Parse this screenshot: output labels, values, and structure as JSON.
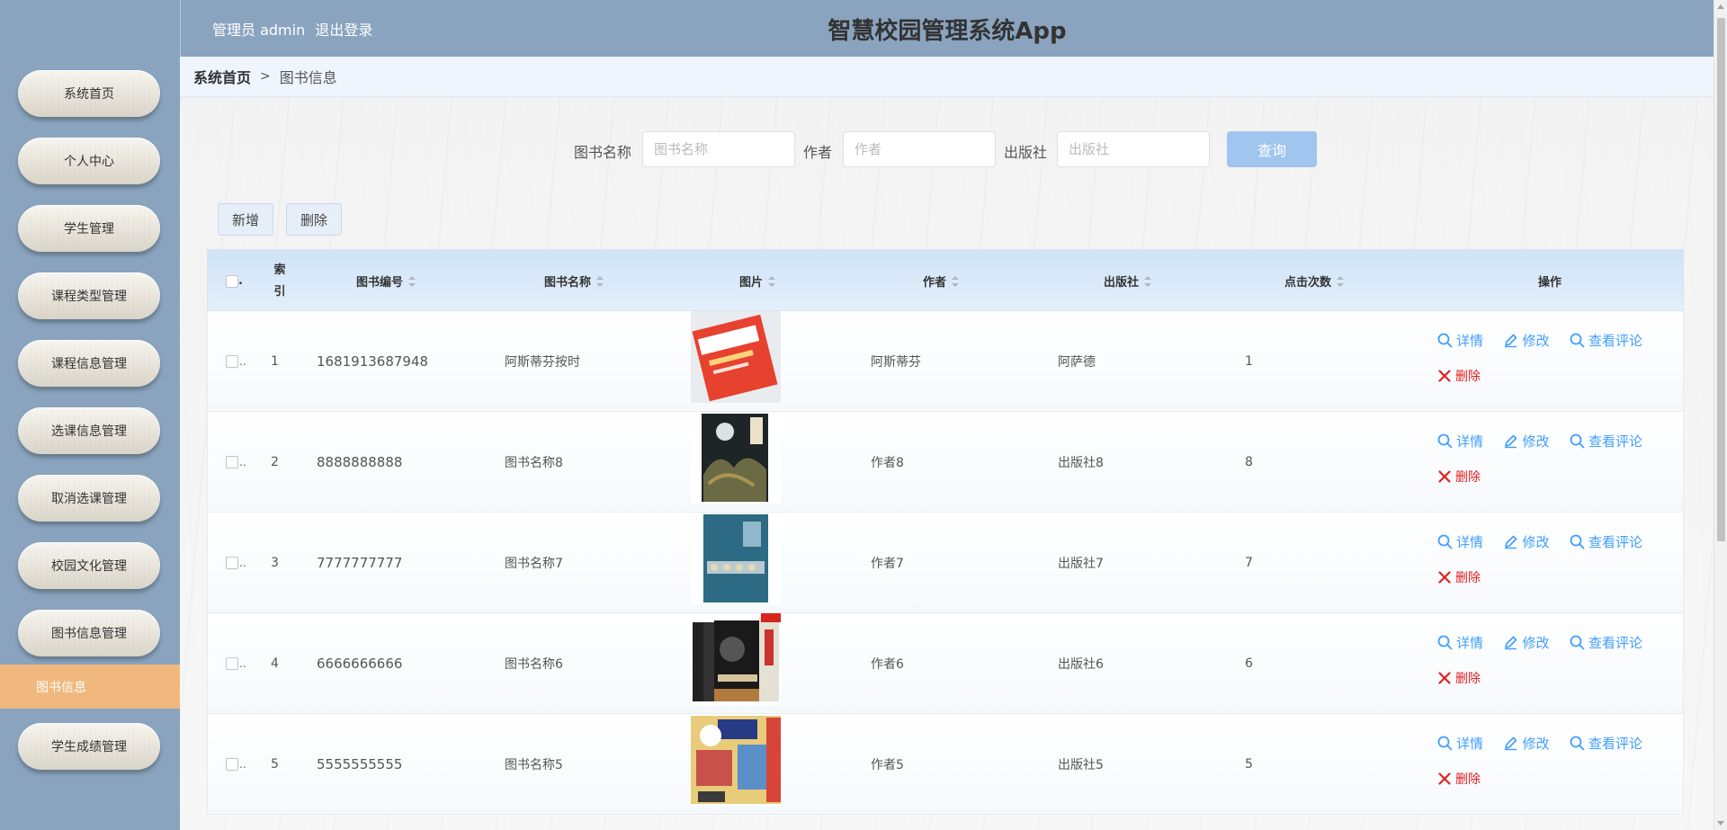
{
  "header": {
    "user_role": "管理员 admin",
    "logout": "退出登录",
    "app_title": "智慧校园管理系统App"
  },
  "sidebar": {
    "items": [
      {
        "label": "系统首页"
      },
      {
        "label": "个人中心"
      },
      {
        "label": "学生管理"
      },
      {
        "label": "课程类型管理"
      },
      {
        "label": "课程信息管理"
      },
      {
        "label": "选课信息管理"
      },
      {
        "label": "取消选课管理"
      },
      {
        "label": "校园文化管理"
      },
      {
        "label": "图书信息管理"
      }
    ],
    "active_sub": "图书信息",
    "last_item": "学生成绩管理",
    "active_color": "#f0b87e"
  },
  "breadcrumb": {
    "home": "系统首页",
    "separator": ">",
    "current": "图书信息"
  },
  "search": {
    "name_label": "图书名称",
    "name_placeholder": "图书名称",
    "author_label": "作者",
    "author_placeholder": "作者",
    "publisher_label": "出版社",
    "publisher_placeholder": "出版社",
    "query_button": "查询"
  },
  "actions": {
    "add": "新增",
    "delete": "删除"
  },
  "table": {
    "headers": {
      "index": "索引",
      "book_no": "图书编号",
      "book_name": "图书名称",
      "image": "图片",
      "author": "作者",
      "publisher": "出版社",
      "clicks": "点击次数",
      "ops": "操作"
    },
    "checkbox_suffix": "..",
    "ops": {
      "detail": "详情",
      "edit": "修改",
      "comments": "查看评论",
      "delete": "删除"
    },
    "rows": [
      {
        "index": "1",
        "book_no": "1681913687948",
        "book_name": "阿斯蒂芬按时",
        "author": "阿斯蒂芬",
        "publisher": "阿萨德",
        "clicks": "1",
        "cover": "red-textbook"
      },
      {
        "index": "2",
        "book_no": "8888888888",
        "book_name": "图书名称8",
        "author": "作者8",
        "publisher": "出版社8",
        "clicks": "8",
        "cover": "dark-fantasy"
      },
      {
        "index": "3",
        "book_no": "7777777777",
        "book_name": "图书名称7",
        "author": "作者7",
        "publisher": "出版社7",
        "clicks": "7",
        "cover": "blue-gems"
      },
      {
        "index": "4",
        "book_no": "6666666666",
        "book_name": "图书名称6",
        "author": "作者6",
        "publisher": "出版社6",
        "clicks": "6",
        "cover": "boxed-set"
      },
      {
        "index": "5",
        "book_no": "5555555555",
        "book_name": "图书名称5",
        "author": "作者5",
        "publisher": "出版社5",
        "clicks": "5",
        "cover": "one-piece"
      }
    ]
  },
  "colors": {
    "primary_blue": "#409eff",
    "danger_red": "#e02020",
    "header_bg": "#8aa4bf"
  }
}
